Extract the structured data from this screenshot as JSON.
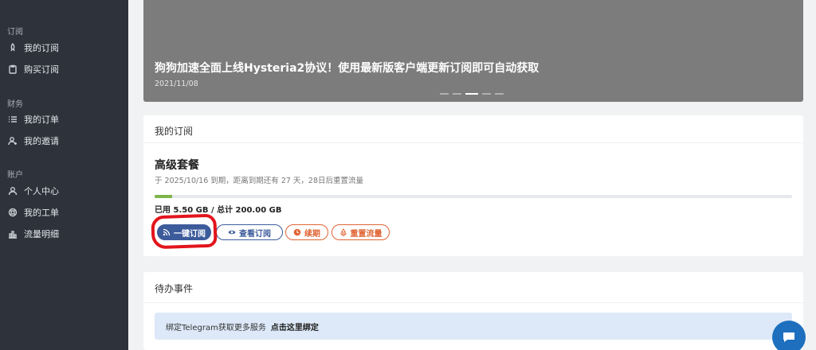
{
  "sidebar": {
    "groups": [
      {
        "label": "订阅",
        "items": [
          {
            "label": "我的订阅",
            "icon": "rocket-icon"
          },
          {
            "label": "购买订阅",
            "icon": "clipboard-icon"
          }
        ]
      },
      {
        "label": "财务",
        "items": [
          {
            "label": "我的订单",
            "icon": "list-icon"
          },
          {
            "label": "我的邀请",
            "icon": "user-plus-icon"
          }
        ]
      },
      {
        "label": "账户",
        "items": [
          {
            "label": "个人中心",
            "icon": "user-icon"
          },
          {
            "label": "我的工单",
            "icon": "lifebuoy-icon"
          },
          {
            "label": "流量明细",
            "icon": "bar-chart-icon"
          }
        ]
      }
    ]
  },
  "banner": {
    "title": "狗狗加速全面上线Hysteria2协议！使用最新版客户端更新订阅即可自动获取",
    "date": "2021/11/08",
    "slide_count": 5,
    "active_slide": 3
  },
  "subscription": {
    "header": "我的订阅",
    "plan_name": "高级套餐",
    "info": "于 2025/10/16 到期，距离到期还有 27 天，28日后重置流量",
    "usage_text": "已用 5.50 GB / 总计 200.00 GB",
    "usage_fraction": 0.0275,
    "buttons": {
      "subscribe": "一键订阅",
      "view": "查看订阅",
      "renew": "续期",
      "reset": "重置流量"
    }
  },
  "todo": {
    "header": "待办事件",
    "alert_text": "绑定Telegram获取更多服务",
    "alert_link": "点击这里绑定"
  },
  "colors": {
    "sidebar_bg": "#2e323b",
    "primary": "#3c5b9b",
    "warning": "#e06434",
    "progress": "#7db548",
    "annotation": "#e3141c"
  }
}
